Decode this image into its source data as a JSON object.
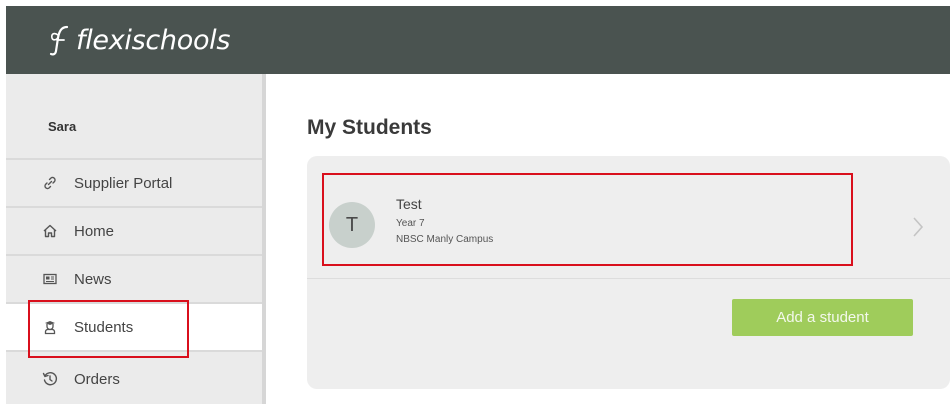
{
  "header": {
    "logo_text": "flexischools",
    "bg_color": "#4a5350"
  },
  "sidebar": {
    "user_name": "Sara",
    "items": [
      {
        "label": "Supplier Portal",
        "icon": "link-icon",
        "active": false
      },
      {
        "label": "Home",
        "icon": "home-icon",
        "active": false
      },
      {
        "label": "News",
        "icon": "news-icon",
        "active": false
      },
      {
        "label": "Students",
        "icon": "student-icon",
        "active": true
      },
      {
        "label": "Orders",
        "icon": "history-icon",
        "active": false
      }
    ]
  },
  "main": {
    "title": "My Students",
    "students": [
      {
        "initial": "T",
        "name": "Test",
        "year": "Year 7",
        "campus": "NBSC Manly Campus"
      }
    ],
    "add_button_label": "Add a student",
    "accent_color": "#9fcc5b",
    "highlight_color": "#d90f1c"
  }
}
